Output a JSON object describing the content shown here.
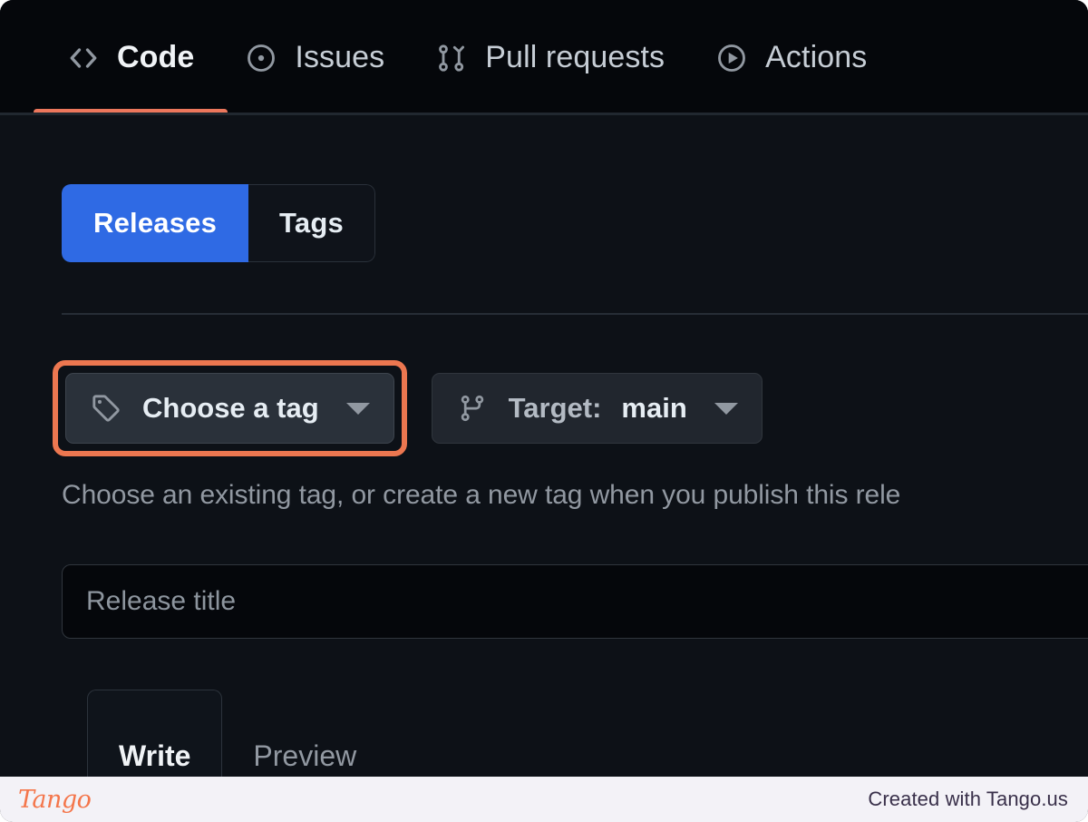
{
  "repo_nav": {
    "items": [
      {
        "label": "Code",
        "icon": "code-icon",
        "active": true
      },
      {
        "label": "Issues",
        "icon": "issue-opened-icon",
        "active": false
      },
      {
        "label": "Pull requests",
        "icon": "git-pull-request-icon",
        "active": false
      },
      {
        "label": "Actions",
        "icon": "play-icon",
        "active": false
      }
    ]
  },
  "segmented": {
    "releases_label": "Releases",
    "tags_label": "Tags",
    "selected": "Releases",
    "selected_color": "#2f6ae4"
  },
  "tag_row": {
    "choose_tag_label": "Choose a tag",
    "choose_tag_icon": "tag-icon",
    "choose_tag_caret": "chevron-down-icon",
    "highlighted": true,
    "highlight_color": "#ec7750",
    "target_prefix": "Target:",
    "target_value": "main",
    "target_icon": "git-branch-icon",
    "target_caret": "chevron-down-icon"
  },
  "tag_help_text": "Choose an existing tag, or create a new tag when you publish this rele",
  "release_title": {
    "placeholder": "Release title",
    "value": ""
  },
  "editor_tabs": [
    {
      "label": "Write",
      "active": true
    },
    {
      "label": "Preview",
      "active": false
    }
  ],
  "footer": {
    "logo_text": "Tango",
    "note": "Created with Tango.us",
    "logo_color": "#f4764b"
  }
}
